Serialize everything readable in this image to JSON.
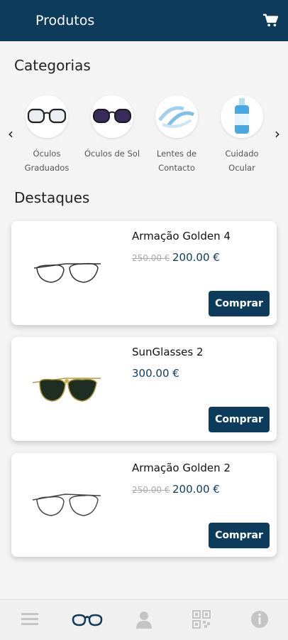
{
  "header": {
    "title": "Produtos",
    "cart_icon": "shopping-cart-icon"
  },
  "categories": {
    "title": "Categorias",
    "items": [
      {
        "label": "Óculos Graduados",
        "icon": "prescription-glasses-icon"
      },
      {
        "label": "Óculos de Sol",
        "icon": "sunglasses-icon"
      },
      {
        "label": "Lentes de Contacto",
        "icon": "contact-lens-icon"
      },
      {
        "label": "Cuidado Ocular",
        "icon": "eye-care-bottle-icon"
      }
    ]
  },
  "featured": {
    "title": "Destaques",
    "products": [
      {
        "name": "Armação Golden 4",
        "old_price": "250.00 €",
        "price": "200.00 €",
        "button": "Comprar"
      },
      {
        "name": "SunGlasses 2",
        "old_price": "",
        "price": "300.00 €",
        "button": "Comprar"
      },
      {
        "name": "Armação Golden 2",
        "old_price": "250.00 €",
        "price": "200.00 €",
        "button": "Comprar"
      }
    ]
  },
  "bottom_nav": {
    "items": [
      {
        "icon": "menu-icon",
        "active": false
      },
      {
        "icon": "glasses-icon",
        "active": true
      },
      {
        "icon": "user-icon",
        "active": false
      },
      {
        "icon": "qr-code-icon",
        "active": false
      },
      {
        "icon": "info-icon",
        "active": false
      }
    ]
  },
  "colors": {
    "primary": "#0d3b5c",
    "background": "#f4f4f4",
    "inactive_icon": "#c4c4c4"
  }
}
